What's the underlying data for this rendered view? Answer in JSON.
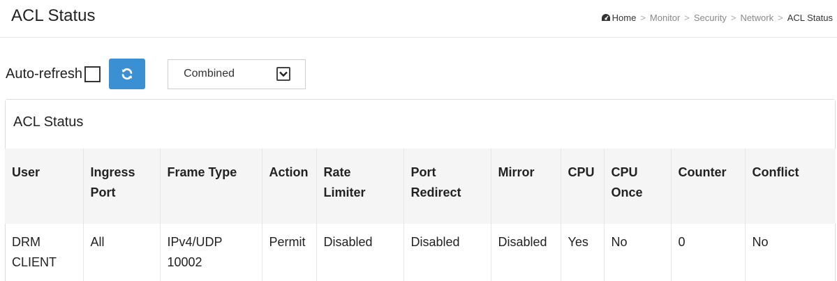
{
  "page": {
    "title": "ACL Status"
  },
  "breadcrumb": {
    "items": [
      "Home",
      "Monitor",
      "Security",
      "Network",
      "ACL Status"
    ],
    "separator": ">"
  },
  "toolbar": {
    "auto_refresh_label": "Auto-refresh",
    "auto_refresh_checked": false,
    "refresh_icon": "refresh-icon",
    "refresh_button_color": "#3b8fd3",
    "user_select_value": "Combined"
  },
  "panel": {
    "heading": "ACL Status"
  },
  "table": {
    "columns": [
      "User",
      "Ingress Port",
      "Frame Type",
      "Action",
      "Rate Limiter",
      "Port Redirect",
      "Mirror",
      "CPU",
      "CPU Once",
      "Counter",
      "Conflict"
    ],
    "rows": [
      [
        "DRM CLIENT",
        "All",
        "IPv4/UDP 10002",
        "Permit",
        "Disabled",
        "Disabled",
        "Disabled",
        "Yes",
        "No",
        "0",
        "No"
      ]
    ]
  }
}
